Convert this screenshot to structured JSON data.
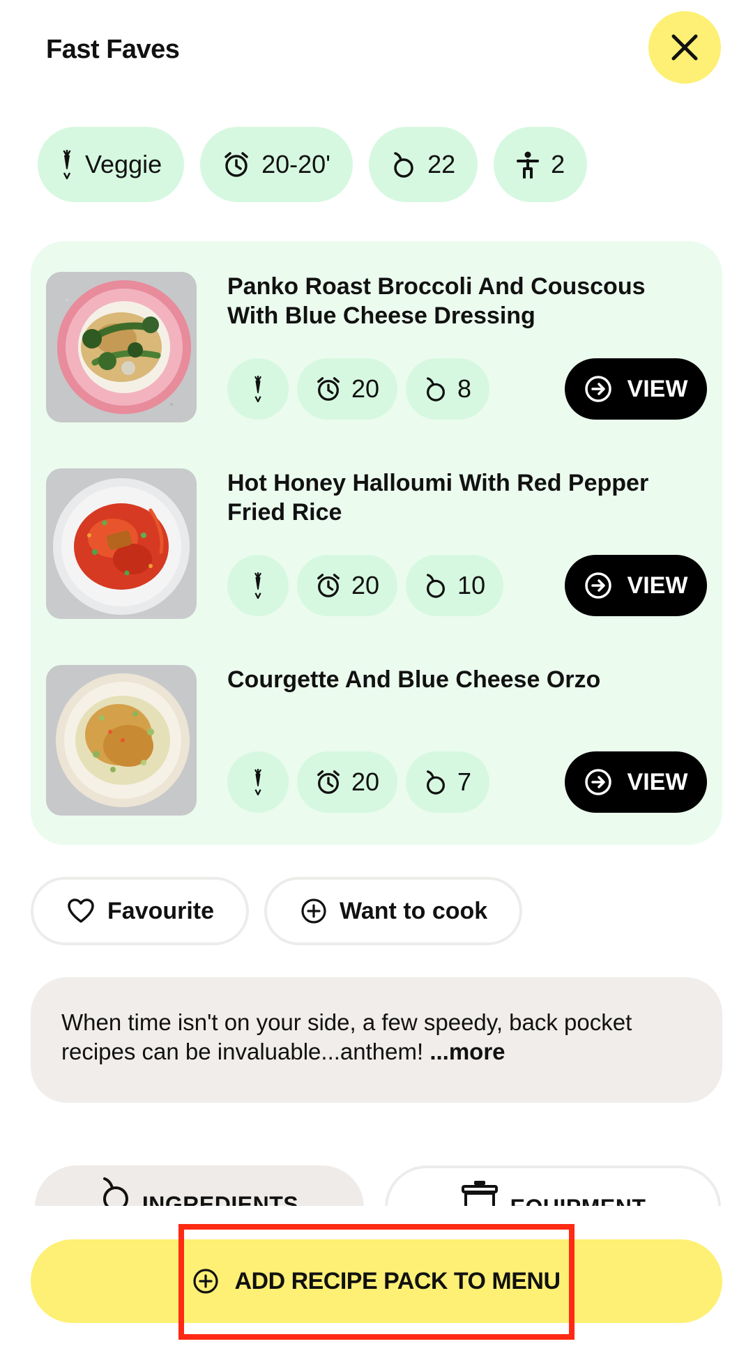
{
  "header": {
    "title": "Fast Faves",
    "close_icon": "close-icon"
  },
  "tags": [
    {
      "icon": "carrot-v-icon",
      "label": "Veggie"
    },
    {
      "icon": "alarm-clock-icon",
      "label": "20-20'"
    },
    {
      "icon": "apple-icon",
      "label": "22"
    },
    {
      "icon": "person-icon",
      "label": "2"
    }
  ],
  "recipes": [
    {
      "title": "Panko Roast Broccoli And Couscous With Blue Cheese Dressing",
      "time": "20",
      "ingredients": "8",
      "view_label": "VIEW",
      "image": "broccoli-couscous-plate"
    },
    {
      "title": "Hot Honey Halloumi With Red Pepper Fried Rice",
      "time": "20",
      "ingredients": "10",
      "view_label": "VIEW",
      "image": "halloumi-fried-rice-plate"
    },
    {
      "title": "Courgette And Blue Cheese Orzo",
      "time": "20",
      "ingredients": "7",
      "view_label": "VIEW",
      "image": "courgette-orzo-plate"
    }
  ],
  "actions": {
    "favourite_label": "Favourite",
    "want_to_cook_label": "Want to cook"
  },
  "description": {
    "text": "When time isn't on your side, a few speedy, back pocket recipes can be invaluable...anthem! ",
    "more_label": "...more"
  },
  "tabs": {
    "ingredients_label": "INGREDIENTS",
    "equipment_label": "EQUIPMENT"
  },
  "cta": {
    "label": "ADD RECIPE PACK TO MENU"
  },
  "colors": {
    "accent_yellow": "#fdf074",
    "mint": "#d6f8e0",
    "mint_light": "#ebfbee",
    "highlight": "#ff2a13"
  }
}
